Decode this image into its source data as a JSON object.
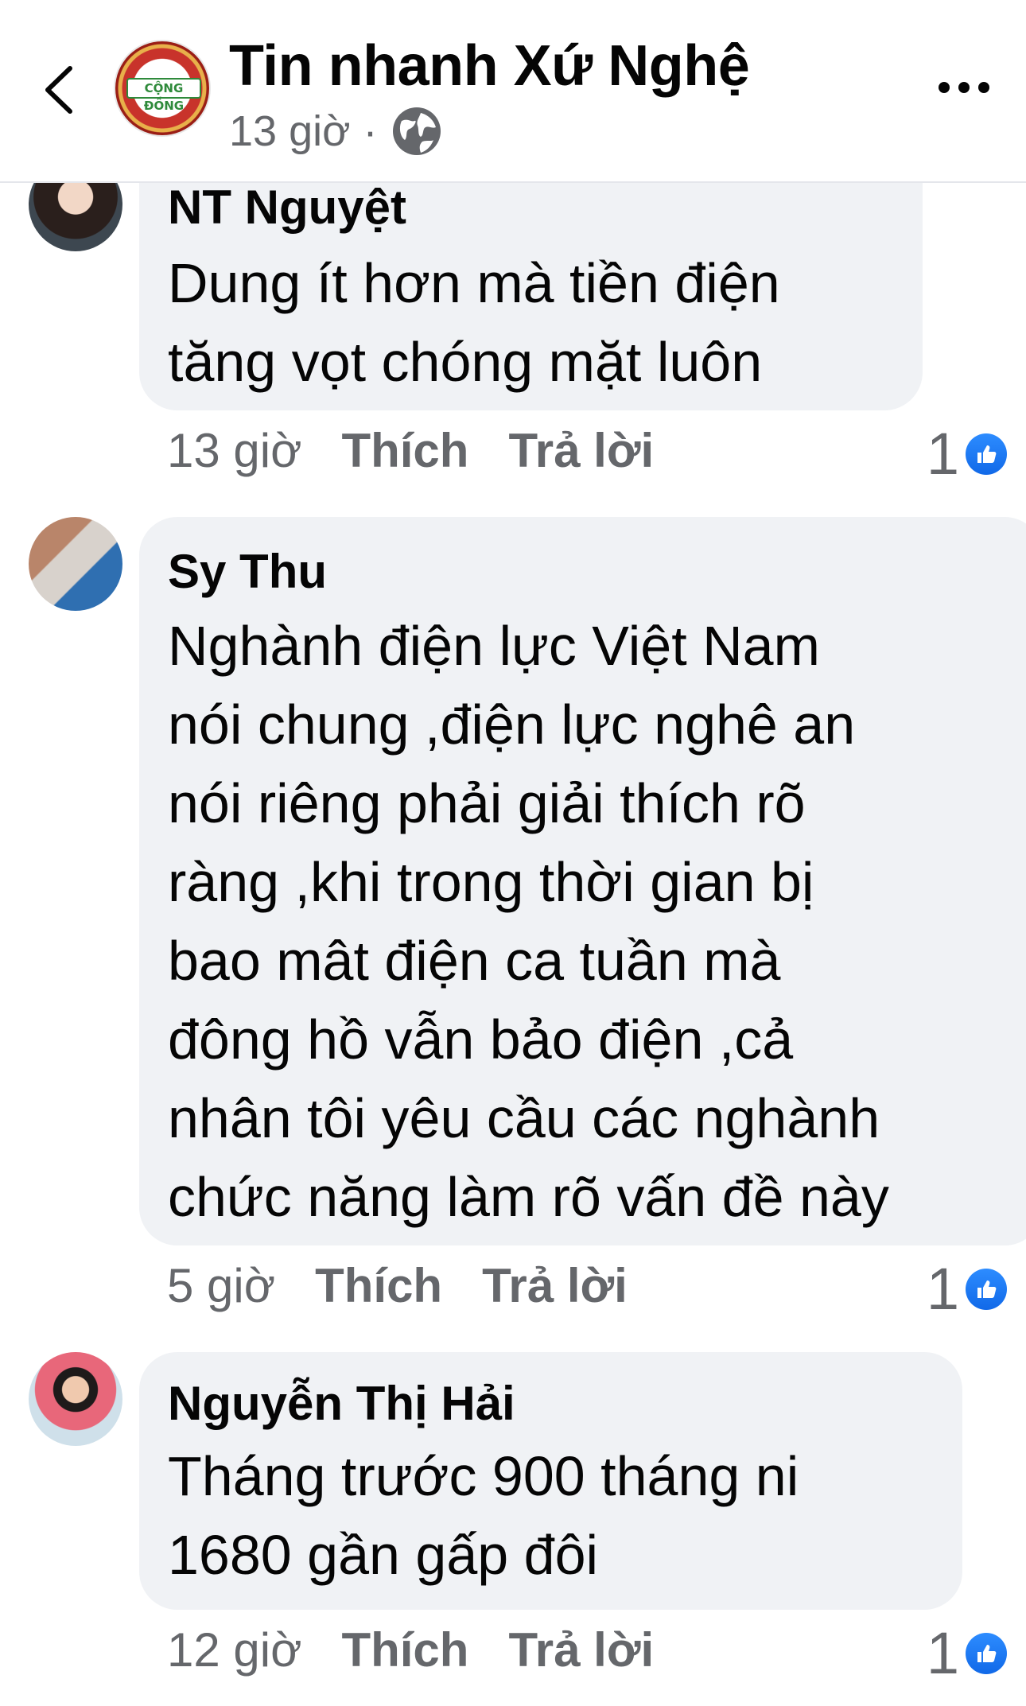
{
  "header": {
    "page_name": "Tin nhanh Xứ Nghệ",
    "post_time": "13 giờ",
    "separator": "·",
    "avatar_logo_text": "CỘNG ĐỒNG",
    "back_icon": "chevron-left-icon",
    "privacy_icon": "globe-icon",
    "more_icon": "more-icon"
  },
  "comments": [
    {
      "author": "NT Nguyệt",
      "text": "Dung ít hơn mà tiền điện\ntăng vọt chóng mặt luôn",
      "time": "13 giờ",
      "like_label": "Thích",
      "reply_label": "Trả lời",
      "reaction_count": "1"
    },
    {
      "author": "Sy Thu",
      "text": "Nghành điện lực Việt Nam\nnói chung ,điện lực nghê an\nnói riêng phải giải thích rõ\nràng ,khi trong thời gian bị\nbao mât điện ca tuần mà\nđông hồ vẫn bảo điện ,cả\nnhân tôi yêu cầu các nghành\nchức năng làm rõ vấn đề này",
      "time": "5 giờ",
      "like_label": "Thích",
      "reply_label": "Trả lời",
      "reaction_count": "1"
    },
    {
      "author": "Nguyễn Thị Hải",
      "text": "Tháng trước 900 tháng ni\n1680  gần gấp đôi",
      "time": "12 giờ",
      "like_label": "Thích",
      "reply_label": "Trả lời",
      "reaction_count": "1"
    }
  ],
  "colors": {
    "bubble": "#f0f2f5",
    "meta_text": "#65676b",
    "like_blue": "#1877f2"
  }
}
